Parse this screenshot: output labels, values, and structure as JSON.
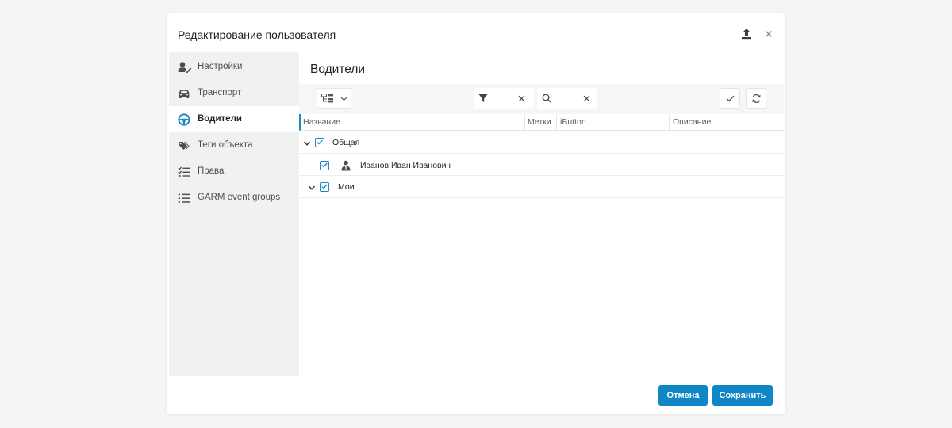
{
  "dialog": {
    "title": "Редактирование пользователя",
    "export_icon": "upload-icon",
    "close_icon": "close-icon"
  },
  "sidebar": {
    "items": [
      {
        "label": "Настройки",
        "icon": "user-settings-icon",
        "active": false
      },
      {
        "label": "Транспорт",
        "icon": "car-icon",
        "active": false
      },
      {
        "label": "Водители",
        "icon": "steering-wheel-icon",
        "active": true
      },
      {
        "label": "Теги объекта",
        "icon": "tags-icon",
        "active": false
      },
      {
        "label": "Права",
        "icon": "checklist-icon",
        "active": false
      },
      {
        "label": "GARM event groups",
        "icon": "list-icon",
        "active": false
      }
    ]
  },
  "main": {
    "title": "Водители",
    "toolbar": {
      "tree_icon": "tree-view-icon",
      "filter_icon": "filter-icon",
      "search_icon": "search-icon",
      "filter_value": "",
      "search_value": ""
    },
    "columns": [
      "Название",
      "Метки",
      "iButton",
      "Описание"
    ],
    "rows": [
      {
        "type": "group",
        "label": "Общая",
        "checked": true,
        "expanded": true
      },
      {
        "type": "item",
        "label": "Иванов Иван Иванович",
        "checked": true,
        "icon": "driver-icon"
      },
      {
        "type": "group",
        "label": "Мои",
        "checked": true,
        "expanded": true
      }
    ]
  },
  "footer": {
    "cancel_label": "Отмена",
    "save_label": "Сохранить"
  },
  "colors": {
    "accent": "#1e88c7",
    "button": "#0f86c6",
    "sidebar_bg": "#f1f1f2"
  }
}
